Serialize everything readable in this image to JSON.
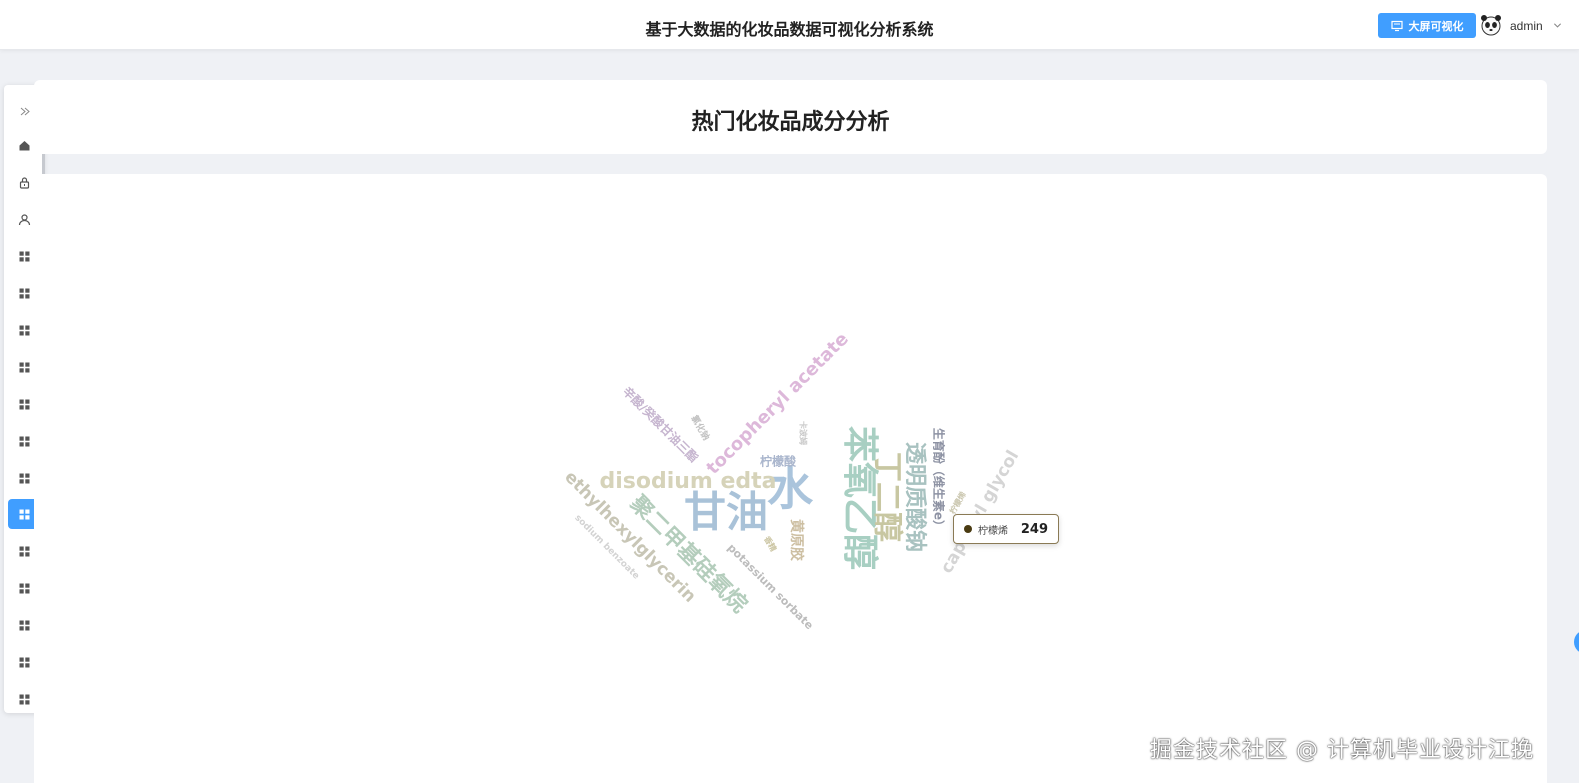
{
  "header": {
    "title": "基于大数据的化妆品数据可视化分析系统",
    "bigscreen_label": "大屏可视化",
    "user_name": "admin"
  },
  "page": {
    "title": "热门化妆品成分分析"
  },
  "sidebar": {
    "items": [
      {
        "icon": "expand-icon"
      },
      {
        "icon": "home-icon"
      },
      {
        "icon": "lock-icon"
      },
      {
        "icon": "user-icon"
      },
      {
        "icon": "grid-icon"
      },
      {
        "icon": "grid-icon"
      },
      {
        "icon": "grid-icon"
      },
      {
        "icon": "grid-icon"
      },
      {
        "icon": "grid-icon"
      },
      {
        "icon": "grid-icon"
      },
      {
        "icon": "grid-icon"
      },
      {
        "icon": "grid-icon",
        "active": true
      },
      {
        "icon": "grid-icon"
      },
      {
        "icon": "grid-icon"
      },
      {
        "icon": "grid-icon"
      },
      {
        "icon": "grid-icon"
      },
      {
        "icon": "grid-icon"
      }
    ]
  },
  "colors": {
    "accent": "#409eff"
  },
  "chart_data": {
    "type": "wordcloud",
    "words": [
      {
        "text": "水",
        "color": "#aac4dc",
        "rank": 1
      },
      {
        "text": "甘油",
        "color": "#a9c2d8",
        "rank": 2
      },
      {
        "text": "苯氧乙醇",
        "color": "#a8cfc2",
        "rank": 3
      },
      {
        "text": "丁二醇",
        "color": "#c8c7a2",
        "rank": 4
      },
      {
        "text": "透明质酸钠",
        "color": "#a8c2c0",
        "rank": 5
      },
      {
        "text": "聚二甲基硅氧烷",
        "color": "#b4cdbc",
        "rank": 6
      },
      {
        "text": "disodium edta",
        "color": "#d6d3b9",
        "rank": 7
      },
      {
        "text": "tocopheryl acetate",
        "color": "#ddb8da",
        "rank": 8
      },
      {
        "text": "ethylhexylglycerin",
        "color": "#c8c6b6",
        "rank": 9
      },
      {
        "text": "caprylyl glycol",
        "color": "#d5d5d5",
        "rank": 10
      },
      {
        "text": "生育酚（维生素e）",
        "color": "#8d92a3",
        "rank": 11
      },
      {
        "text": "黄原胶",
        "color": "#cdbfa2",
        "rank": 12
      },
      {
        "text": "potassium sorbate",
        "color": "#bcbcbc",
        "rank": 13
      },
      {
        "text": "辛酸/癸酸甘油三酯",
        "color": "#c6b5cf",
        "rank": 14
      },
      {
        "text": "柠檬酸",
        "color": "#aab6cd",
        "rank": 15
      },
      {
        "text": "sodium benzoate",
        "color": "#d3d3d3",
        "rank": 16
      },
      {
        "text": "氯化钠",
        "color": "#c2c2c2",
        "rank": 17
      },
      {
        "text": "卡波姆",
        "color": "#c9c9c9",
        "rank": 18
      },
      {
        "text": "柠檬烯",
        "color": "#cbc7b0",
        "rank": 19
      },
      {
        "text": "香精",
        "color": "#ccc6a4",
        "rank": 20
      }
    ],
    "tooltip": {
      "label": "柠檬烯",
      "value": 249
    }
  },
  "watermark": "掘金技术社区 @ 计算机毕业设计江挽"
}
